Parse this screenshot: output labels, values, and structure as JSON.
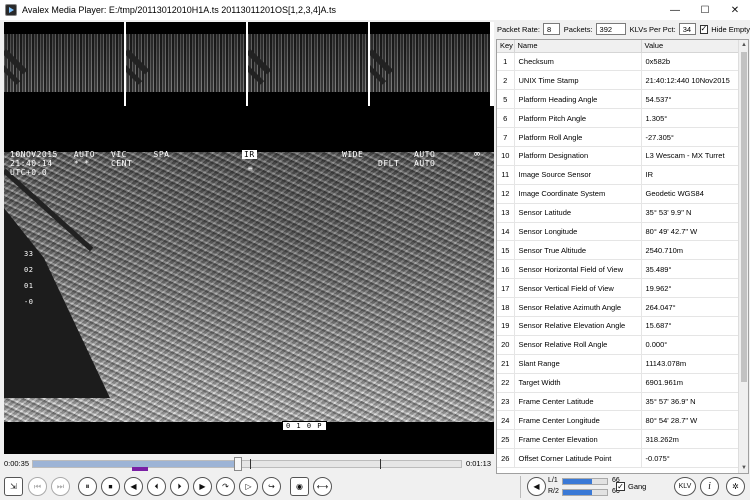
{
  "window": {
    "title": "Avalex Media Player: E:/tmp/20113012010H1A.ts 20113011201OS[1,2,3,4]A.ts",
    "minimize_glyph": "—",
    "maximize_glyph": "☐",
    "close_glyph": "✕"
  },
  "osd": {
    "line1": "10NOV2015   AUTO   VIC     SPA",
    "line2": "21:40:14    * *    CENT",
    "line3": "UTC+0.0",
    "ir_badge": "IR",
    "wide": "WIDE",
    "auto_right": "AUTO",
    "dflt": "DFLT",
    "auto_right2": "AUTO",
    "infinity": "∞",
    "left_scale": "33\n\n02\n\n01\n\n-0",
    "bottom_tag": "0 1 0 P",
    "center_mark": "≡"
  },
  "stats": {
    "packet_rate_label": "Packet Rate:",
    "packet_rate_value": "8",
    "packets_label": "Packets:",
    "packets_value": "392",
    "klvs_label": "KLVs Per Pct:",
    "klvs_value": "34",
    "hide_empty_label": "Hide Empty",
    "hide_empty_check": "✓"
  },
  "klv_table": {
    "headers": {
      "key": "Key",
      "name": "Name",
      "value": "Value"
    },
    "rows": [
      {
        "key": "1",
        "name": "Checksum",
        "value": "0x582b"
      },
      {
        "key": "2",
        "name": "UNIX Time Stamp",
        "value": "21:40:12:440 10Nov2015"
      },
      {
        "key": "5",
        "name": "Platform Heading Angle",
        "value": "54.537°"
      },
      {
        "key": "6",
        "name": "Platform Pitch Angle",
        "value": "1.305°"
      },
      {
        "key": "7",
        "name": "Platform Roll Angle",
        "value": "-27.305°"
      },
      {
        "key": "10",
        "name": "Platform Designation",
        "value": "L3 Wescam - MX Turret"
      },
      {
        "key": "11",
        "name": "Image Source Sensor",
        "value": "IR"
      },
      {
        "key": "12",
        "name": "Image Coordinate System",
        "value": "Geodetic WGS84"
      },
      {
        "key": "13",
        "name": "Sensor Latitude",
        "value": "35° 53' 9.9\" N"
      },
      {
        "key": "14",
        "name": "Sensor Longitude",
        "value": " 80° 49' 42.7\" W"
      },
      {
        "key": "15",
        "name": "Sensor True Altitude",
        "value": "2540.710m"
      },
      {
        "key": "16",
        "name": "Sensor Horizontal Field of View",
        "value": "35.489°"
      },
      {
        "key": "17",
        "name": "Sensor Vertical Field of View",
        "value": "19.962°"
      },
      {
        "key": "18",
        "name": "Sensor Relative Azimuth Angle",
        "value": "264.047°"
      },
      {
        "key": "19",
        "name": "Sensor Relative Elevation Angle",
        "value": "15.687°"
      },
      {
        "key": "20",
        "name": "Sensor Relative Roll Angle",
        "value": "0.000°"
      },
      {
        "key": "21",
        "name": "Slant Range",
        "value": "11143.078m"
      },
      {
        "key": "22",
        "name": "Target Width",
        "value": "6901.961m"
      },
      {
        "key": "23",
        "name": "Frame Center Latitude",
        "value": "35° 57' 36.9\" N"
      },
      {
        "key": "24",
        "name": "Frame Center Longitude",
        "value": " 80° 54' 28.7\" W"
      },
      {
        "key": "25",
        "name": "Frame Center Elevation",
        "value": "318.262m"
      },
      {
        "key": "26",
        "name": "Offset Corner Latitude Point",
        "value": "-0.075°"
      }
    ]
  },
  "timeline": {
    "current_time": "0:00:35",
    "total_time": "0:01:13",
    "played_fraction": 0.48
  },
  "controls": {
    "buttons": [
      "⏮",
      "⏭",
      "⏸",
      "⏹",
      "◀",
      "⏴",
      "⏵",
      "▶",
      "↷",
      "▷",
      "↪",
      "⊙",
      "⟷"
    ],
    "volume": {
      "left_label": "L/1",
      "right_label": "R/2",
      "left_value": "66",
      "right_value": "66",
      "left_level": 0.66,
      "right_level": 0.66
    },
    "gang_label": "Gang",
    "gang_check": "✓",
    "klv_button": "KLV",
    "info_button": "i",
    "settings_button": "✲",
    "speaker_glyph": "◀",
    "camera_glyph": "◉",
    "export_glyph": "⇲"
  },
  "colors": {
    "accent": "#3a79d6",
    "timeline_played": "#9db4d6",
    "timeline_marker": "#7a1fa5"
  }
}
